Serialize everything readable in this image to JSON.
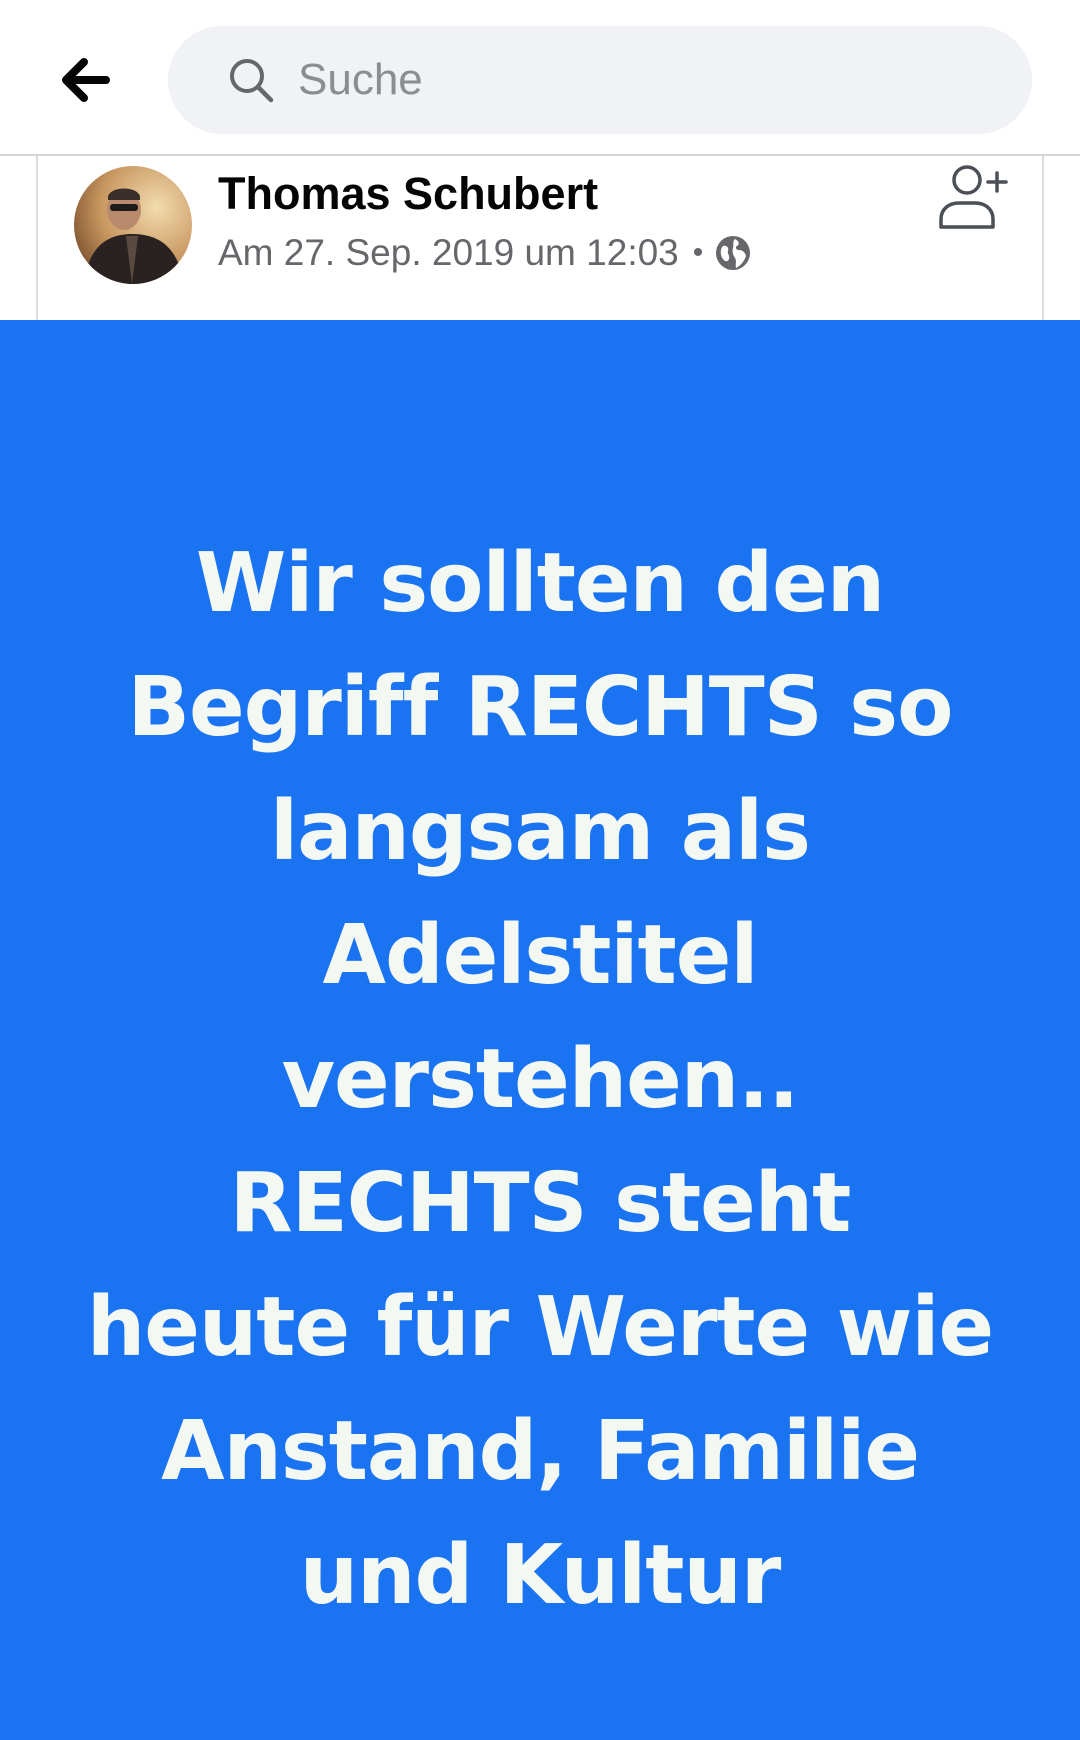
{
  "search": {
    "placeholder": "Suche"
  },
  "post": {
    "author": "Thomas Schubert",
    "timestamp": "Am 27. Sep. 2019 um 12:03",
    "separator": "•",
    "privacy_icon": "globe-icon",
    "image_text_lines": [
      "Wir sollten den",
      "Begriff RECHTS so",
      "langsam als",
      "Adelstitel",
      "verstehen..",
      "RECHTS steht",
      "heute für Werte wie",
      "Anstand, Familie",
      "und Kultur"
    ]
  },
  "colors": {
    "image_background": "#1a73f0",
    "image_text": "#f4f8f3",
    "search_background": "#f0f2f5"
  },
  "icons": {
    "back": "back-arrow-icon",
    "search": "search-icon",
    "add_friend": "add-friend-icon"
  }
}
